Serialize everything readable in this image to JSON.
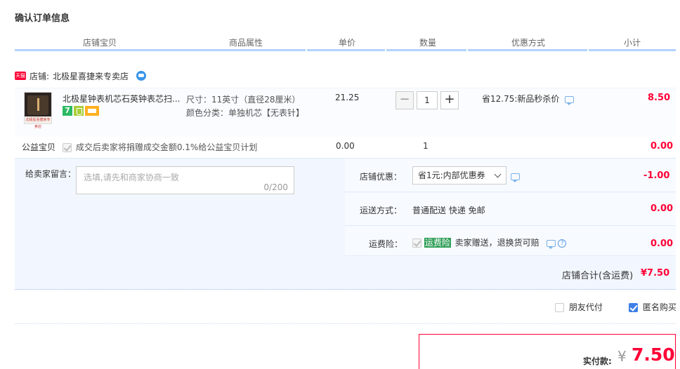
{
  "page_title": "确认订单信息",
  "columns": [
    "店铺宝贝",
    "商品属性",
    "单价",
    "数量",
    "优惠方式",
    "小计"
  ],
  "shop": {
    "badge": "天猫",
    "label": "店铺:",
    "name": "北极星喜捷来专卖店"
  },
  "item": {
    "thumb_caption": "北极星喜捷来专卖店",
    "name": "北极星钟表机芯石英钟表芯扫...",
    "badge7": "7",
    "attr_size": "尺寸：11英寸（直径28厘米）",
    "attr_color": "颜色分类：单独机芯【无表针】",
    "price": "21.25",
    "quantity": "1",
    "discount": "省12.75:新品秒杀价",
    "subtotal": "8.50"
  },
  "charity": {
    "label": "公益宝贝",
    "text": "成交后卖家将捐赠成交金额0.1%给公益宝贝计划",
    "price": "0.00",
    "qty": "1",
    "subtotal": "0.00"
  },
  "message": {
    "label": "给卖家留言：",
    "placeholder": "选填,请先和商家协商一致",
    "counter": "0/200"
  },
  "shop_discount": {
    "label": "店铺优惠：",
    "selected": "省1元:内部优惠券",
    "amount": "-1.00"
  },
  "shipping": {
    "label": "运送方式：",
    "value": "普通配送 快递 免邮",
    "amount": "0.00"
  },
  "insurance": {
    "label": "运费险：",
    "tag": "运费险",
    "text": "卖家赠送，退换货可赔",
    "help": "?",
    "amount": "0.00"
  },
  "shop_total": {
    "label": "店铺合计(含运费)",
    "amount": "¥7.50"
  },
  "options": {
    "friend_pay": "朋友代付",
    "anonymous": "匿名购买"
  },
  "payment": {
    "label": "实付款:",
    "currency": "¥",
    "amount": "7.50"
  }
}
